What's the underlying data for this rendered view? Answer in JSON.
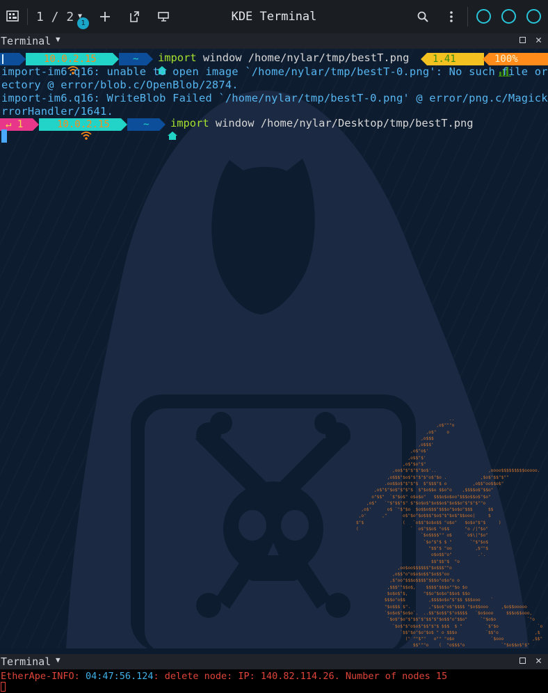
{
  "window": {
    "title": "KDE Terminal",
    "tab_counter": "1 / 2",
    "tab_badge": "1",
    "accent": "#29c5d9"
  },
  "icons": {
    "app_menu": "grid-icon",
    "dropdown": "chevron-down-icon",
    "new_tab": "plus-icon",
    "split": "split-view-icon",
    "load_layout": "display-icon",
    "search": "search-icon",
    "menu": "kebab-menu-icon"
  },
  "pane_top": {
    "title": "Terminal",
    "prompt1": {
      "ip": "10.0.2.15",
      "dir": "~",
      "command": "import",
      "args": "window /home/nylar/tmp/bestT.png",
      "load": "1.41",
      "battery": "100%"
    },
    "errors": [
      "import-im6.q16: unable to open image `/home/nylar/tmp/bestT-0.png': No such file or dir",
      "ectory @ error/blob.c/OpenBlob/2874.",
      "import-im6.q16: WriteBlob Failed `/home/nylar/tmp/bestT-0.png' @ error/png.c/MagickPNGE",
      "rrorHandler/1641."
    ],
    "prompt2": {
      "status": "↵ 1",
      "ip": "10.0.2.15",
      "dir": "~",
      "command": "import",
      "args": "window /home/nylar/Desktop/tmp/bestT.png"
    }
  },
  "pane_bottom": {
    "title": "Terminal",
    "log_source": "EtherApe-INFO",
    "log_time": "04:47:56.124",
    "log_message": ": delete node: IP: 140.82.114.26. Number of nodes 15"
  },
  "colors": {
    "powerline_blue": "#0c4e9a",
    "powerline_cyan": "#22d4c8",
    "powerline_green": "#50fa7b",
    "powerline_yellow": "#f3c221",
    "powerline_orange": "#ff8c1a",
    "powerline_pink": "#e8378a",
    "error_text": "#56b6f0",
    "log_red": "#e0443a"
  }
}
